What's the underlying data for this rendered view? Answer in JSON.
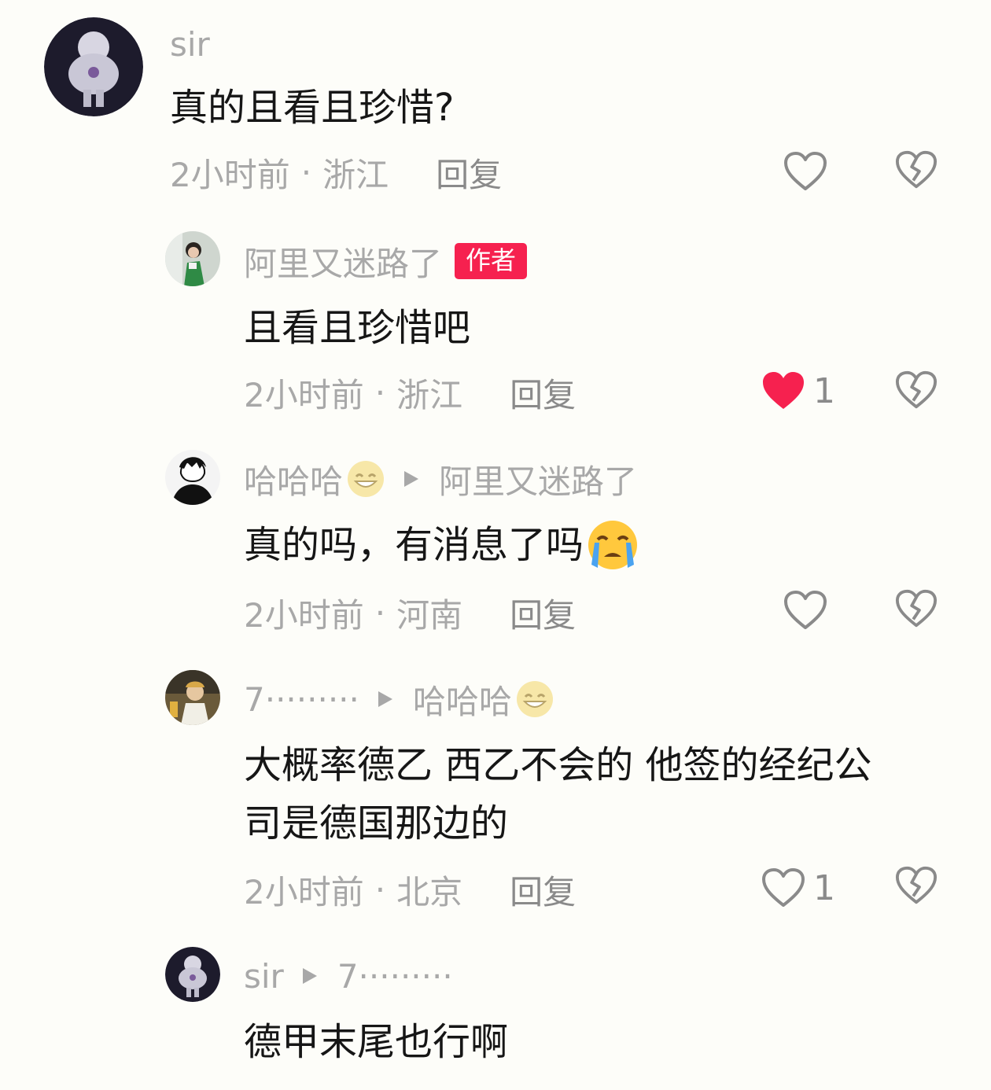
{
  "comments": [
    {
      "name": "sir",
      "text": "真的且看且珍惜?",
      "time": "2小时前",
      "location": "浙江",
      "reply_label": "回复",
      "likes": ""
    },
    {
      "name": "阿里又迷路了",
      "author_badge": "作者",
      "text": "且看且珍惜吧",
      "time": "2小时前",
      "location": "浙江",
      "reply_label": "回复",
      "likes": "1",
      "liked": true
    },
    {
      "name": "哈哈哈",
      "reply_to": "阿里又迷路了",
      "text": "真的吗，有消息了吗",
      "time": "2小时前",
      "location": "河南",
      "reply_label": "回复",
      "likes": ""
    },
    {
      "name": "7·········",
      "reply_to": "哈哈哈",
      "text_line1": "大概率德乙 西乙不会的 他签的经纪公",
      "text_line2": "司是德国那边的",
      "time": "2小时前",
      "location": "北京",
      "reply_label": "回复",
      "likes": "1"
    },
    {
      "name": "sir",
      "reply_to": "7·········",
      "text": "德甲末尾也行啊"
    }
  ],
  "meta_separator": "·",
  "colors": {
    "background": "#fdfdf9",
    "username": "#a8a8a8",
    "author_badge": "#f6214f",
    "liked_heart": "#f6214f"
  },
  "icons": {
    "like": "heart-outline-icon",
    "liked": "heart-filled-icon",
    "dislike": "broken-heart-icon",
    "reply_arrow": "triangle-right-icon",
    "grin_emoji": "grinning-emoji",
    "cry_emoji": "crying-emoji"
  }
}
